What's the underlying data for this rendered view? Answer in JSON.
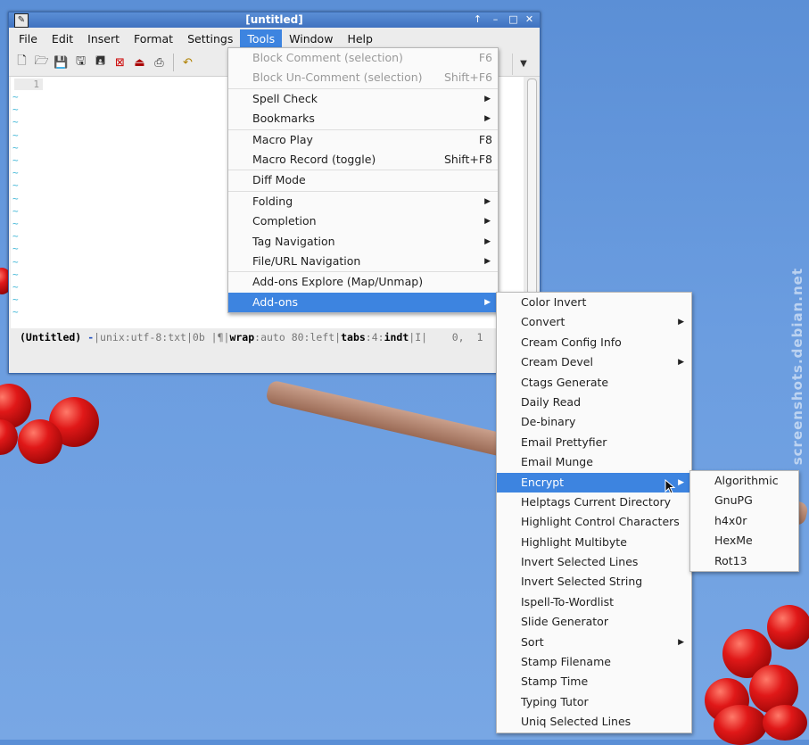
{
  "watermark": "screenshots.debian.net",
  "window": {
    "title": "[untitled]",
    "buttons": [
      "↑",
      "–",
      "□",
      "✕"
    ]
  },
  "menubar": [
    "File",
    "Edit",
    "Insert",
    "Format",
    "Settings",
    "Tools",
    "Window",
    "Help"
  ],
  "editor": {
    "line_number": "1",
    "tilde": "~"
  },
  "status": {
    "name": "(Untitled)",
    "dash": "-",
    "enc": "|unix:utf-8:txt|0b |¶|",
    "wrap_k": "wrap",
    "wrap_v": ":auto 80:left|",
    "tabs_k": "tabs",
    "tabs_v": ":4:",
    "indt_k": "indt",
    "tail": "|I|    0,  1"
  },
  "tools_menu": [
    {
      "label": "Block Comment (selection)",
      "shortcut": "F6",
      "disabled": true
    },
    {
      "label": "Block Un-Comment (selection)",
      "shortcut": "Shift+F6",
      "disabled": true
    },
    {
      "label": "Spell Check",
      "submenu": true
    },
    {
      "label": "Bookmarks",
      "submenu": true
    },
    {
      "label": "Macro Play",
      "shortcut": "F8"
    },
    {
      "label": "Macro Record (toggle)",
      "shortcut": "Shift+F8"
    },
    {
      "label": "Diff Mode"
    },
    {
      "label": "Folding",
      "submenu": true
    },
    {
      "label": "Completion",
      "submenu": true
    },
    {
      "label": "Tag Navigation",
      "submenu": true
    },
    {
      "label": "File/URL Navigation",
      "submenu": true
    },
    {
      "label": "Add-ons Explore (Map/Unmap)"
    },
    {
      "label": "Add-ons",
      "submenu": true,
      "selected": true
    }
  ],
  "addons_menu": [
    {
      "label": "Color Invert"
    },
    {
      "label": "Convert",
      "submenu": true
    },
    {
      "label": "Cream Config Info"
    },
    {
      "label": "Cream Devel",
      "submenu": true
    },
    {
      "label": "Ctags Generate"
    },
    {
      "label": "Daily Read"
    },
    {
      "label": "De-binary"
    },
    {
      "label": "Email Prettyfier"
    },
    {
      "label": "Email Munge"
    },
    {
      "label": "Encrypt",
      "submenu": true,
      "selected": true
    },
    {
      "label": "Helptags Current Directory"
    },
    {
      "label": "Highlight Control Characters"
    },
    {
      "label": "Highlight Multibyte"
    },
    {
      "label": "Invert Selected Lines"
    },
    {
      "label": "Invert Selected String"
    },
    {
      "label": "Ispell-To-Wordlist"
    },
    {
      "label": "Slide Generator"
    },
    {
      "label": "Sort",
      "submenu": true
    },
    {
      "label": "Stamp Filename"
    },
    {
      "label": "Stamp Time"
    },
    {
      "label": "Typing Tutor"
    },
    {
      "label": "Uniq Selected Lines"
    }
  ],
  "encrypt_menu": [
    {
      "label": "Algorithmic"
    },
    {
      "label": "GnuPG"
    },
    {
      "label": "h4x0r"
    },
    {
      "label": "HexMe"
    },
    {
      "label": "Rot13"
    }
  ]
}
